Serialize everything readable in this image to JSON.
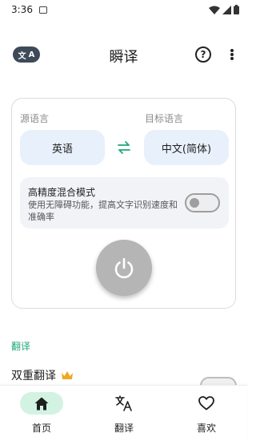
{
  "status_bar": {
    "time": "3:36"
  },
  "app_bar": {
    "logo": {
      "left_glyph": "文",
      "right_glyph": "A"
    },
    "title": "瞬译",
    "help_glyph": "?"
  },
  "translator": {
    "source_label": "源语言",
    "target_label": "目标语言",
    "source_language": "英语",
    "target_language": "中文(简体)"
  },
  "mode": {
    "title": "高精度混合模式",
    "description": "使用无障碍功能，提高文字识别速度和准确率",
    "enabled": false
  },
  "section": {
    "header": "翻译",
    "dual_translation_label": "双重翻译"
  },
  "bottom_nav": [
    {
      "label": "首页",
      "active": true
    },
    {
      "label": "翻译",
      "active": false
    },
    {
      "label": "喜欢",
      "active": false
    }
  ],
  "colors": {
    "accent_green": "#1fa67a",
    "nav_active_bg": "#d2f3e1",
    "lang_button_bg": "#e8f0fb",
    "power_button": "#b5b5b5",
    "crown": "#f0a722"
  }
}
